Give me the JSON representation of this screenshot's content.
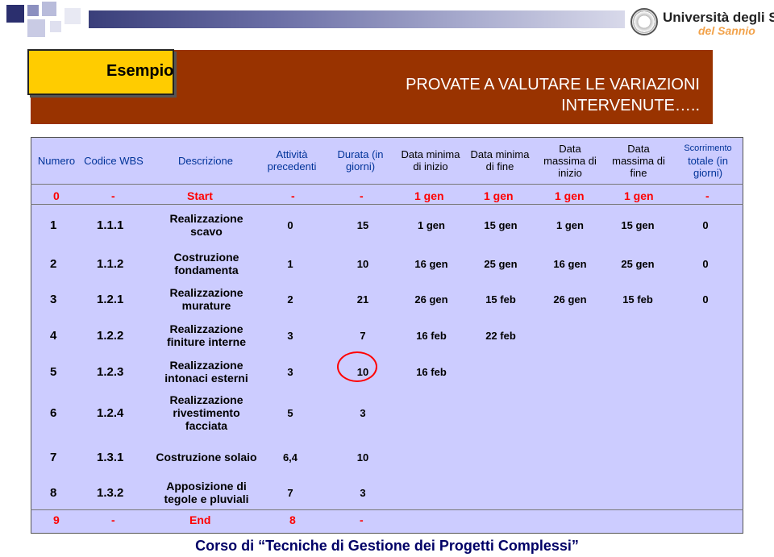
{
  "brand": {
    "university": "Università degli Studi",
    "university_sub": "del Sannio"
  },
  "callout": {
    "label": "Esempio"
  },
  "banner": {
    "line1": "PROVATE A VALUTARE LE VARIAZIONI",
    "line2": "INTERVENUTE….."
  },
  "headers": {
    "numero": "Numero",
    "codice": "Codice WBS",
    "descrizione": "Descrizione",
    "attivita": "Attività precedenti",
    "durata": "Durata (in giorni)",
    "min_inizio": "Data minima di inizio",
    "min_fine": "Data minima di fine",
    "max_inizio": "Data massima di inizio",
    "max_fine": "Data massima di fine",
    "scorrimento": "Scorrimento",
    "scorrimento2": "totale (in giorni)"
  },
  "start_row": {
    "numero": "0",
    "codice": "-",
    "descrizione": "Start",
    "attivita": "-",
    "durata": "-",
    "min_inizio": "1 gen",
    "min_fine": "1 gen",
    "max_inizio": "1 gen",
    "max_fine": "1 gen",
    "scorrimento": "-"
  },
  "rows": [
    {
      "numero": "1",
      "codice": "1.1.1",
      "descrizione": "Realizzazione scavo",
      "attivita": "0",
      "durata": "15",
      "min_inizio": "1 gen",
      "min_fine": "15 gen",
      "max_inizio": "1 gen",
      "max_fine": "15 gen",
      "scorrimento": "0"
    },
    {
      "numero": "2",
      "codice": "1.1.2",
      "descrizione": "Costruzione fondamenta",
      "attivita": "1",
      "durata": "10",
      "min_inizio": "16 gen",
      "min_fine": "25 gen",
      "max_inizio": "16 gen",
      "max_fine": "25 gen",
      "scorrimento": "0"
    },
    {
      "numero": "3",
      "codice": "1.2.1",
      "descrizione": "Realizzazione murature",
      "attivita": "2",
      "durata": "21",
      "min_inizio": "26 gen",
      "min_fine": "15 feb",
      "max_inizio": "26 gen",
      "max_fine": "15 feb",
      "scorrimento": "0"
    },
    {
      "numero": "4",
      "codice": "1.2.2",
      "descrizione": "Realizzazione finiture interne",
      "attivita": "3",
      "durata": "7",
      "min_inizio": "16 feb",
      "min_fine": "22 feb",
      "max_inizio": "",
      "max_fine": "",
      "scorrimento": ""
    },
    {
      "numero": "5",
      "codice": "1.2.3",
      "descrizione": "Realizzazione intonaci esterni",
      "attivita": "3",
      "durata": "10",
      "min_inizio": "16 feb",
      "min_fine": "",
      "max_inizio": "",
      "max_fine": "",
      "scorrimento": ""
    },
    {
      "numero": "6",
      "codice": "1.2.4",
      "descrizione": "Realizzazione rivestimento facciata",
      "attivita": "5",
      "durata": "3",
      "min_inizio": "",
      "min_fine": "",
      "max_inizio": "",
      "max_fine": "",
      "scorrimento": ""
    },
    {
      "numero": "7",
      "codice": "1.3.1",
      "descrizione": "Costruzione solaio",
      "attivita": "6,4",
      "durata": "10",
      "min_inizio": "",
      "min_fine": "",
      "max_inizio": "",
      "max_fine": "",
      "scorrimento": ""
    },
    {
      "numero": "8",
      "codice": "1.3.2",
      "descrizione": "Apposizione di tegole e pluviali",
      "attivita": "7",
      "durata": "3",
      "min_inizio": "",
      "min_fine": "",
      "max_inizio": "",
      "max_fine": "",
      "scorrimento": ""
    }
  ],
  "end_row": {
    "numero": "9",
    "codice": "-",
    "descrizione": "End",
    "attivita": "8",
    "durata": "-"
  },
  "footer": {
    "text": "Corso di “Tecniche di Gestione dei Progetti Complessi”"
  },
  "colors": {
    "banner": "#993300",
    "callout": "#ffcc00",
    "table_bg": "#ccccff",
    "accent_red": "#ff0000",
    "footer": "#000066"
  }
}
